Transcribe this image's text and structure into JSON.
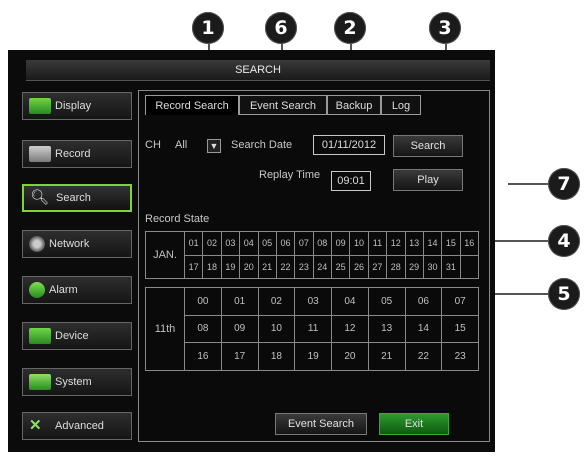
{
  "callouts": [
    "1",
    "6",
    "2",
    "3",
    "7",
    "4",
    "5"
  ],
  "window": {
    "title": "SEARCH"
  },
  "sidebar": {
    "items": [
      {
        "label": "Display",
        "icon": "display-icon"
      },
      {
        "label": "Record",
        "icon": "record-icon"
      },
      {
        "label": "Search",
        "icon": "search-icon"
      },
      {
        "label": "Network",
        "icon": "network-icon"
      },
      {
        "label": "Alarm",
        "icon": "alarm-icon"
      },
      {
        "label": "Device",
        "icon": "device-icon"
      },
      {
        "label": "System",
        "icon": "system-icon"
      },
      {
        "label": "Advanced",
        "icon": "advanced-icon"
      }
    ]
  },
  "tabs": [
    "Record Search",
    "Event Search",
    "Backup",
    "Log"
  ],
  "form": {
    "ch_label": "CH",
    "ch_value": "All",
    "search_date_label": "Search Date",
    "search_date_value": "01/11/2012",
    "search_button": "Search",
    "replay_time_label": "Replay Time",
    "replay_time_value": "09:01",
    "play_button": "Play"
  },
  "record_state": {
    "label": "Record State",
    "month_label": "JAN.",
    "days_row1": [
      "01",
      "02",
      "03",
      "04",
      "05",
      "06",
      "07",
      "08",
      "09",
      "10",
      "11",
      "12",
      "13",
      "14",
      "15",
      "16"
    ],
    "days_row2": [
      "17",
      "18",
      "19",
      "20",
      "21",
      "22",
      "23",
      "24",
      "25",
      "26",
      "27",
      "28",
      "29",
      "30",
      "31",
      ""
    ],
    "day_label": "11th",
    "hours_rows": [
      [
        "00",
        "01",
        "02",
        "03",
        "04",
        "05",
        "06",
        "07"
      ],
      [
        "08",
        "09",
        "10",
        "11",
        "12",
        "13",
        "14",
        "15"
      ],
      [
        "16",
        "17",
        "18",
        "19",
        "20",
        "21",
        "22",
        "23"
      ]
    ]
  },
  "footer": {
    "event_search_button": "Event Search",
    "exit_button": "Exit"
  },
  "colors": {
    "active_border": "#7fd23a",
    "exit_green": "#2d9a2d",
    "screen_bg": "#0b0b0b"
  }
}
